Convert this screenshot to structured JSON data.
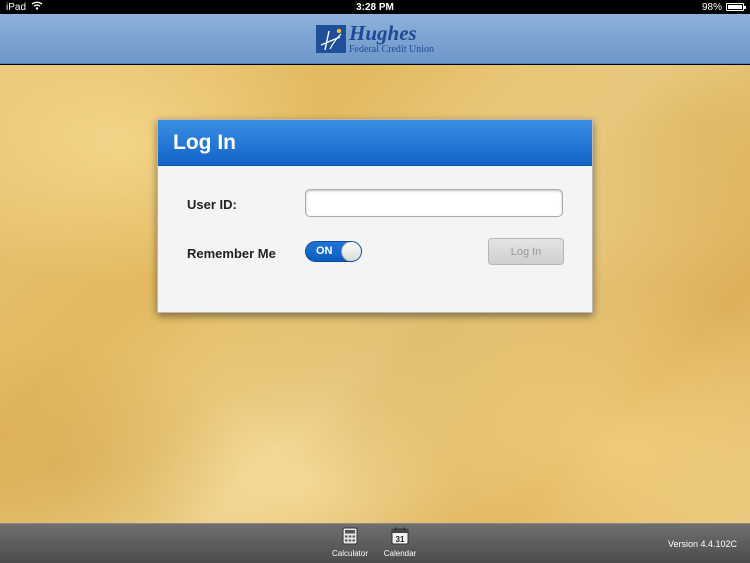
{
  "status_bar": {
    "device": "iPad",
    "time": "3:28 PM",
    "battery": "98%",
    "battery_level": 0.98
  },
  "header": {
    "logo_name": "Hughes",
    "logo_sub": "Federal Credit Union"
  },
  "dialog": {
    "title": "Log In",
    "userid_label": "User ID:",
    "userid_value": "",
    "remember_label": "Remember Me",
    "toggle_state": "ON",
    "login_button": "Log In"
  },
  "toolbar": {
    "calculator_label": "Calculator",
    "calendar_label": "Calendar",
    "calendar_day": "31",
    "version": "Version 4.4.102C"
  },
  "colors": {
    "header_blue": "#7aa3d3",
    "dialog_header": "#1f74d8",
    "toggle_on": "#1f74d8",
    "toolbar": "#5c5c5c"
  }
}
